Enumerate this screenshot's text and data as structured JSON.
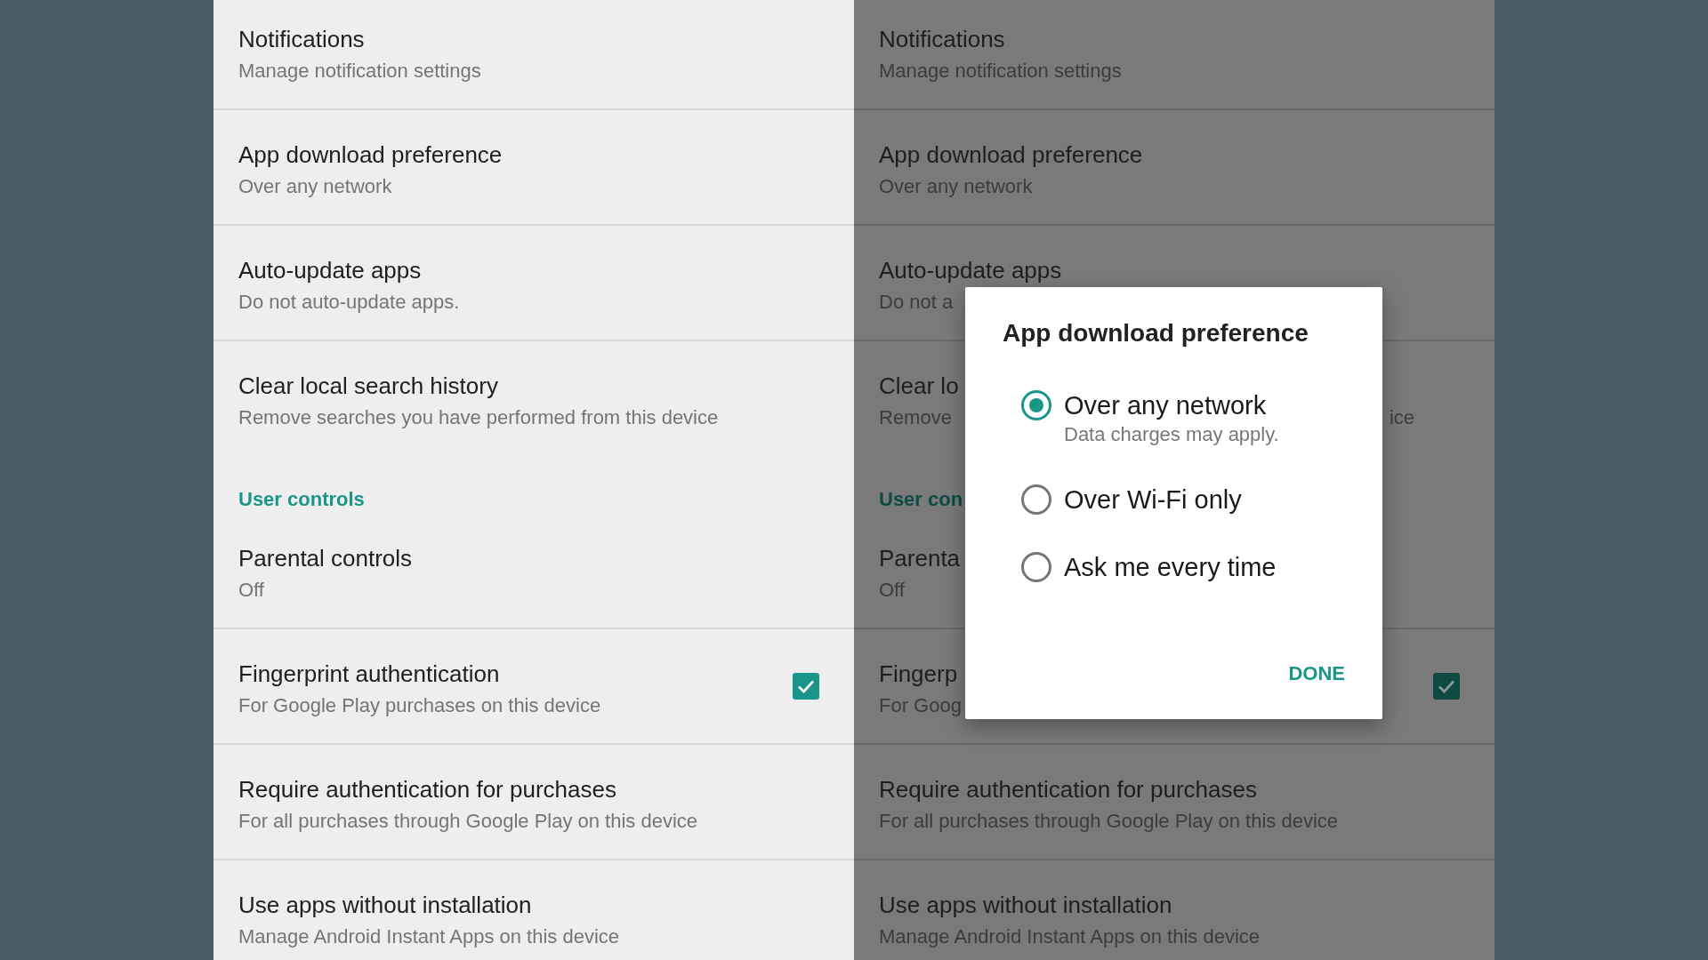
{
  "panels": [
    {
      "dimmed": false,
      "items": [
        {
          "kind": "setting",
          "title": "Notifications",
          "subtitle": "Manage notification settings"
        },
        {
          "kind": "setting",
          "title": "App download preference",
          "subtitle": "Over any network"
        },
        {
          "kind": "setting",
          "title": "Auto-update apps",
          "subtitle": "Do not auto-update apps."
        },
        {
          "kind": "setting",
          "title": "Clear local search history",
          "subtitle": "Remove searches you have performed from this device"
        },
        {
          "kind": "header",
          "title": "User controls"
        },
        {
          "kind": "setting",
          "title": "Parental controls",
          "subtitle": "Off"
        },
        {
          "kind": "checkbox",
          "title": "Fingerprint authentication",
          "subtitle": "For Google Play purchases on this device",
          "checked": true
        },
        {
          "kind": "setting",
          "title": "Require authentication for purchases",
          "subtitle": "For all purchases through Google Play on this device"
        },
        {
          "kind": "setting",
          "title": "Use apps without installation",
          "subtitle": "Manage Android Instant Apps on this device"
        }
      ]
    },
    {
      "dimmed": true,
      "items": [
        {
          "kind": "setting",
          "title": "Notifications",
          "subtitle": "Manage notification settings"
        },
        {
          "kind": "setting",
          "title": "App download preference",
          "subtitle": "Over any network"
        },
        {
          "kind": "setting",
          "title": "Auto-update apps",
          "subtitle": "Do not a"
        },
        {
          "kind": "setting",
          "title": "Clear lo",
          "subtitle": "Remove",
          "subtitle_tail": "ice"
        },
        {
          "kind": "header",
          "title": "User con"
        },
        {
          "kind": "setting",
          "title": "Parenta",
          "subtitle": "Off"
        },
        {
          "kind": "checkbox",
          "title": "Fingerp",
          "subtitle": "For Goog",
          "checked": true
        },
        {
          "kind": "setting",
          "title": "Require authentication for purchases",
          "subtitle": "For all purchases through Google Play on this device"
        },
        {
          "kind": "setting",
          "title": "Use apps without installation",
          "subtitle": "Manage Android Instant Apps on this device"
        }
      ],
      "dialog": {
        "title": "App download preference",
        "options": [
          {
            "label": "Over any network",
            "hint": "Data charges may apply.",
            "selected": true
          },
          {
            "label": "Over Wi-Fi only",
            "selected": false
          },
          {
            "label": "Ask me every time",
            "selected": false
          }
        ],
        "button": "DONE"
      }
    }
  ]
}
